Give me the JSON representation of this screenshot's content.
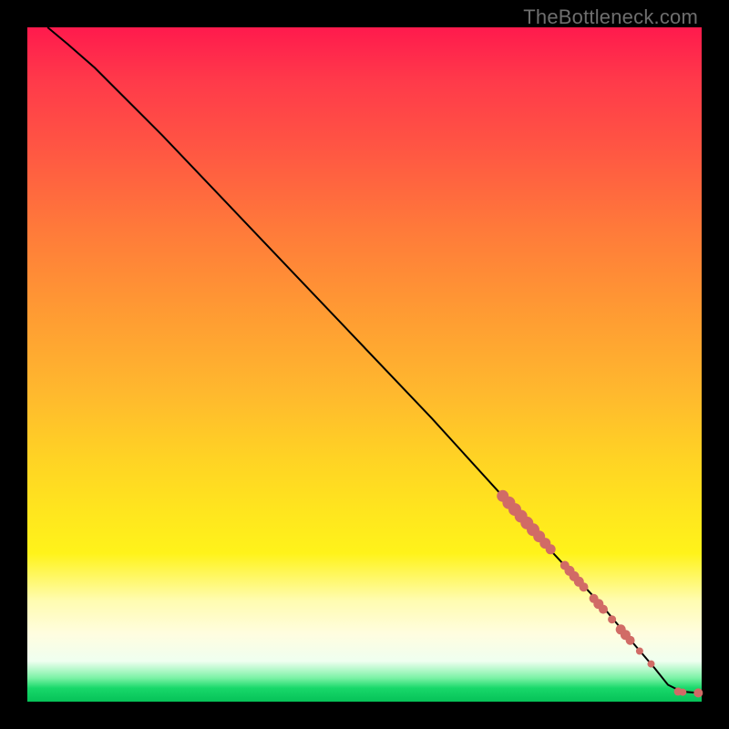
{
  "watermark": "TheBottleneck.com",
  "colors": {
    "dot": "#d16b66",
    "curve": "#000000"
  },
  "chart_data": {
    "type": "line",
    "title": "",
    "xlabel": "",
    "ylabel": "",
    "xlim": [
      0,
      100
    ],
    "ylim": [
      0,
      100
    ],
    "series": [
      {
        "name": "curve",
        "x": [
          3,
          6,
          10,
          20,
          30,
          40,
          50,
          60,
          70,
          78,
          85,
          90,
          93,
          95,
          97,
          99.5
        ],
        "y": [
          100,
          97.5,
          94,
          84,
          73.5,
          63,
          52.5,
          42,
          31,
          22,
          14.5,
          8.5,
          5,
          2.5,
          1.5,
          1.3
        ]
      }
    ],
    "points": [
      {
        "x": 70.5,
        "y": 30.5,
        "r": 6.5
      },
      {
        "x": 71.4,
        "y": 29.5,
        "r": 7
      },
      {
        "x": 72.3,
        "y": 28.5,
        "r": 7
      },
      {
        "x": 73.2,
        "y": 27.5,
        "r": 7
      },
      {
        "x": 74.1,
        "y": 26.5,
        "r": 7
      },
      {
        "x": 75.0,
        "y": 25.5,
        "r": 7
      },
      {
        "x": 75.9,
        "y": 24.5,
        "r": 6.5
      },
      {
        "x": 76.8,
        "y": 23.5,
        "r": 6
      },
      {
        "x": 77.6,
        "y": 22.6,
        "r": 5.5
      },
      {
        "x": 79.7,
        "y": 20.2,
        "r": 5
      },
      {
        "x": 80.4,
        "y": 19.4,
        "r": 5.5
      },
      {
        "x": 81.1,
        "y": 18.6,
        "r": 5.5
      },
      {
        "x": 81.8,
        "y": 17.8,
        "r": 5.5
      },
      {
        "x": 82.5,
        "y": 17.0,
        "r": 5
      },
      {
        "x": 84.0,
        "y": 15.3,
        "r": 5
      },
      {
        "x": 84.7,
        "y": 14.5,
        "r": 5.5
      },
      {
        "x": 85.4,
        "y": 13.7,
        "r": 5
      },
      {
        "x": 86.7,
        "y": 12.2,
        "r": 4.5
      },
      {
        "x": 88.0,
        "y": 10.7,
        "r": 5.5
      },
      {
        "x": 88.7,
        "y": 9.9,
        "r": 5.5
      },
      {
        "x": 89.4,
        "y": 9.1,
        "r": 5
      },
      {
        "x": 90.8,
        "y": 7.5,
        "r": 4
      },
      {
        "x": 92.5,
        "y": 5.6,
        "r": 4
      },
      {
        "x": 96.5,
        "y": 1.5,
        "r": 4.5
      },
      {
        "x": 97.2,
        "y": 1.4,
        "r": 4
      },
      {
        "x": 99.5,
        "y": 1.3,
        "r": 5
      }
    ]
  }
}
